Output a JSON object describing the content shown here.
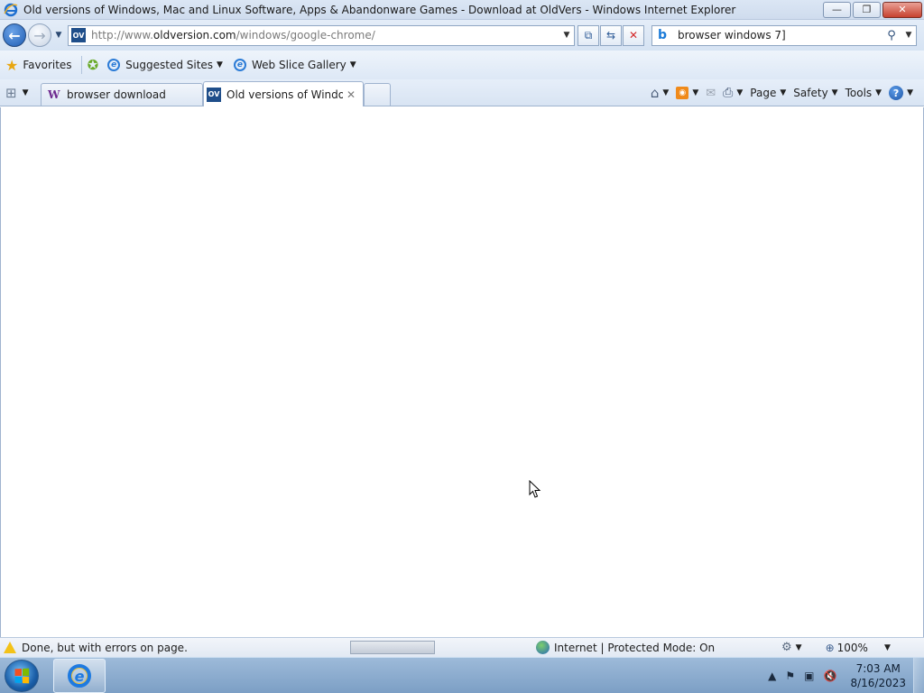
{
  "window": {
    "title": "Old versions of Windows, Mac and Linux Software, Apps & Abandonware Games - Download at OldVers - Windows Internet Explorer",
    "min_label": "—",
    "restore_label": "❐",
    "close_label": "✕"
  },
  "address": {
    "url_prefix": "http://www.",
    "url_domain": "oldversion.com",
    "url_path": "/windows/google-chrome/",
    "favicon": "OV"
  },
  "search": {
    "value": "browser windows 7]"
  },
  "favorites_bar": {
    "favorites_label": "Favorites",
    "suggested_label": "Suggested Sites",
    "webslice_label": "Web Slice Gallery"
  },
  "tabs": [
    {
      "label": "browser download",
      "icon": "W",
      "active": false
    },
    {
      "label": "Old versions of Windo...",
      "icon": "OV",
      "active": true
    }
  ],
  "command_bar": {
    "page_label": "Page",
    "safety_label": "Safety",
    "tools_label": "Tools"
  },
  "status": {
    "text": "Done, but with errors on page.",
    "zone": "Internet | Protected Mode: On",
    "zoom": "100%"
  },
  "taskbar": {
    "time": "7:03 AM",
    "date": "8/16/2023"
  },
  "icons": [
    "ie-logo-icon",
    "back-icon",
    "forward-icon",
    "compatibility-icon",
    "refresh-icon",
    "stop-icon",
    "bing-icon",
    "search-icon",
    "star-icon",
    "add-favorite-icon",
    "home-icon",
    "rss-icon",
    "mail-icon",
    "print-icon",
    "help-icon",
    "warning-icon",
    "globe-icon",
    "zoom-icon",
    "windows-logo-icon",
    "flag-icon",
    "network-icon",
    "volume-muted-icon"
  ]
}
